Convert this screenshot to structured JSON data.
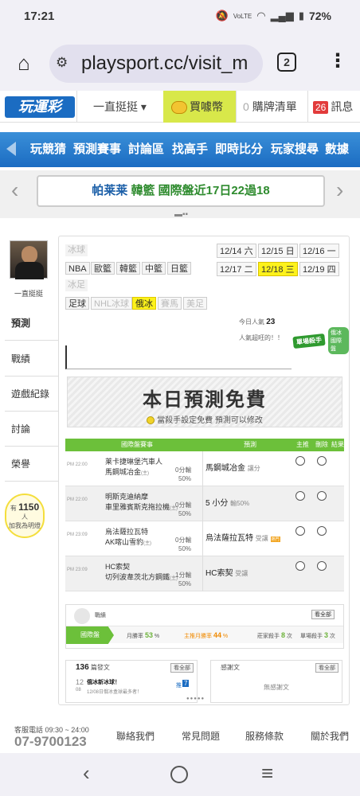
{
  "status": {
    "time": "17:21",
    "network": "VoLTE",
    "battery": "72%"
  },
  "browser": {
    "url": "playsport.cc/visit_m",
    "tab_count": "2"
  },
  "site_nav": {
    "logo": "玩運彩",
    "follow": "一直挺挺 ▾",
    "buy": "買噱幣",
    "cart_count": "0",
    "cart": "購牌清單",
    "msg_count": "26",
    "msg": "訊息"
  },
  "menu": [
    "玩競猜",
    "預測賽事",
    "討論區",
    "找高手",
    "即時比分",
    "玩家搜尋",
    "數據"
  ],
  "marquee": {
    "text_prefix": "帕莱莱",
    "text_highlight": "韓籃",
    "text_suffix": "國際盤近17日22過18"
  },
  "left": {
    "username": "一直挺挺",
    "tabs": [
      "預測",
      "戰績",
      "遊戲紀錄",
      "討論",
      "榮譽"
    ],
    "fans_prefix": "有",
    "fans_count": "1150",
    "fans_unit": "人",
    "fans_note": "加我為明燈"
  },
  "sports": {
    "label_basketball": "冰球",
    "row1": [
      "NBA",
      "歐籃",
      "韓籃",
      "中籃",
      "日籃"
    ],
    "label_other": "冰足",
    "row2": [
      "足球",
      "NHL冰球",
      "俄冰",
      "賽馬",
      "美足"
    ]
  },
  "dates": [
    "12/14 六",
    "12/15 日",
    "12/16 一",
    "12/17 二",
    "12/18 三",
    "12/19 四"
  ],
  "popularity": {
    "label": "今日人氣",
    "value": "23",
    "note": "人氣超旺的！！"
  },
  "badge": {
    "main": "單場殺手",
    "sub": "俄冰國際盤"
  },
  "free_banner": {
    "title": "本日預測免費",
    "subtitle": "當殺手設定免費  預測可以修改"
  },
  "table": {
    "headers": [
      "國際盤賽事",
      "預測",
      "主推",
      "刪除",
      "結果"
    ],
    "rows": [
      {
        "time": "PM 22:00",
        "team1": "莱卡捷琳堡汽車人",
        "team2": "馬鋼城冶金",
        "team2_tag": "(主)",
        "odds1": "0分輸",
        "odds2": "50%",
        "pick": "馬鋼城冶金",
        "pick_note": "讓分",
        "hot": ""
      },
      {
        "time": "PM 22:00",
        "team1": "明斯克迪納摩",
        "team2": "車里雅賓斯克拖拉機",
        "team2_tag": "(主)",
        "odds1": "0分輸",
        "odds2": "50%",
        "pick": "5 小分",
        "pick_note": "輸50%",
        "hot": ""
      },
      {
        "time": "PM 23:09",
        "team1": "烏法薩拉瓦特",
        "team2": "AK喀山雪豹",
        "team2_tag": "(主)",
        "odds1": "0分輸",
        "odds2": "50%",
        "pick": "烏法薩拉瓦特",
        "pick_note": "受讓",
        "hot": "熱門"
      },
      {
        "time": "PM 23:09",
        "team1": "HC索契",
        "team2": "切列波韋茨北方鋼鐵",
        "team2_tag": "(主)",
        "odds1": "1分輸",
        "odds2": "50%",
        "pick": "HC索契",
        "pick_note": "受讓",
        "hot": ""
      }
    ]
  },
  "record": {
    "label": "戰績",
    "view_all": "看全部",
    "tag": "國際盤",
    "month_label": "月勝率",
    "month_value": "53",
    "month_unit": "%",
    "main_label": "主推月勝率",
    "main_value": "44",
    "main_unit": "%",
    "streak_label": "莊家殺手",
    "streak_value": "8",
    "streak_unit": "次",
    "single_label": "單場殺手",
    "single_value": "3",
    "single_unit": "次"
  },
  "articles": {
    "count": "136",
    "count_label": "篇發文",
    "view_all": "看全部",
    "date_day": "12",
    "date_mon": "08",
    "title": "俄冰新冰球！",
    "snippet": "12/08日俄冰盒球最多者！",
    "push_label": "推",
    "push_count": "7",
    "thanks_label": "感謝文",
    "thanks_view_all": "看全部",
    "thanks_empty": "無感謝文"
  },
  "footer": {
    "phone_label": "客服電話 09:30 ~ 24:00",
    "phone": "07-9700123",
    "links": [
      "聯絡我們",
      "常見問題",
      "服務條款",
      "關於我們"
    ]
  }
}
